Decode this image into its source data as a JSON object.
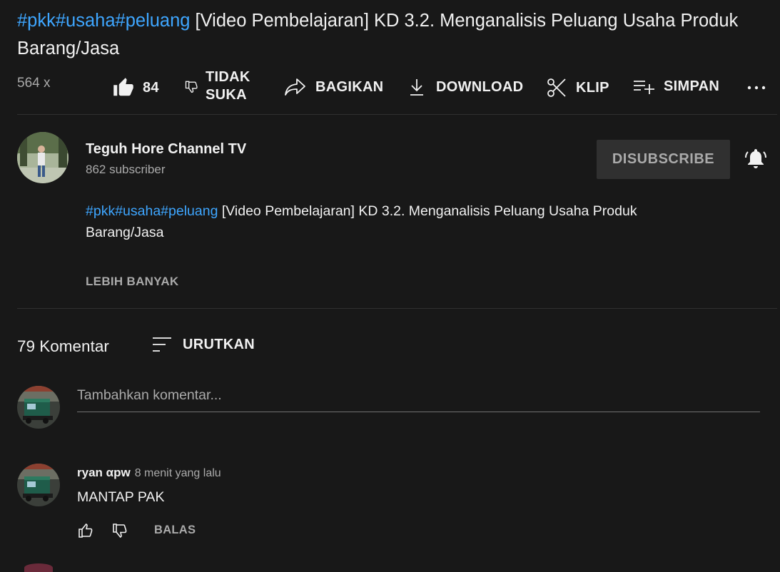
{
  "video": {
    "title_tags": "#pkk#usaha#peluang",
    "title_rest": " [Video Pembelajaran] KD 3.2. Menganalisis Peluang Usaha Produk Barang/Jasa",
    "views": "564 x"
  },
  "actions": {
    "like_count": "84",
    "dislike_line1": "TIDAK",
    "dislike_line2": "SUKA",
    "share": "BAGIKAN",
    "download": "DOWNLOAD",
    "clip": "KLIP",
    "save": "SIMPAN"
  },
  "channel": {
    "name": "Teguh Hore Channel TV",
    "subscribers": "862 subscriber",
    "unsubscribe": "DISUBSCRIBE"
  },
  "description": {
    "tags": "#pkk#usaha#peluang",
    "text": " [Video Pembelajaran] KD 3.2.  Menganalisis Peluang Usaha Produk Barang/Jasa",
    "more": "LEBIH BANYAK"
  },
  "comments": {
    "count": "79 Komentar",
    "sort": "URUTKAN",
    "placeholder": "Tambahkan komentar...",
    "items": [
      {
        "author": "ryan αpw",
        "time": "8 menit yang lalu",
        "text": "MANTAP PAK",
        "reply": "BALAS"
      }
    ]
  },
  "colors": {
    "background": "#181818",
    "link": "#3ea6ff",
    "muted": "#aaaaaa",
    "divider": "#303030"
  },
  "icons": [
    "like-icon",
    "dislike-icon",
    "share-icon",
    "download-icon",
    "clip-icon",
    "save-icon",
    "more-icon",
    "bell-icon",
    "sort-icon"
  ]
}
